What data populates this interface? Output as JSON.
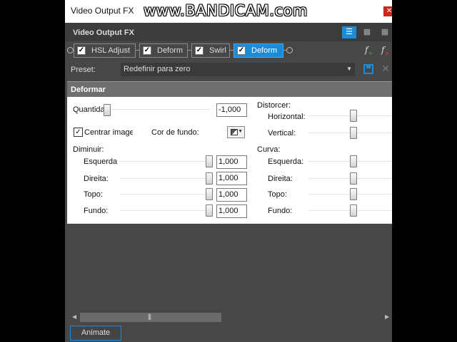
{
  "window": {
    "title": "Video Output FX",
    "close_glyph": "✕"
  },
  "watermark": "www.BANDICAM.com",
  "panel": {
    "title": "Video Output FX"
  },
  "fx_chain": [
    {
      "label": "HSL Adjust",
      "checked": true,
      "selected": false
    },
    {
      "label": "Deform",
      "checked": true,
      "selected": false
    },
    {
      "label": "Swirl",
      "checked": true,
      "selected": false
    },
    {
      "label": "Deform",
      "checked": true,
      "selected": true
    }
  ],
  "preset": {
    "label": "Preset:",
    "value": "Redefinir para zero"
  },
  "section": {
    "title": "Deformar"
  },
  "quantidade": {
    "label": "Quantida",
    "value": "-1,000"
  },
  "centrar": {
    "label": "Centrar imagem",
    "checked": true
  },
  "cor_fundo": {
    "label": "Cor de fundo:"
  },
  "distorcer": {
    "label": "Distorcer:",
    "horizontal": "Horizontal:",
    "vertical": "Vertical:"
  },
  "diminuir": {
    "label": "Diminuir:",
    "rows": [
      {
        "label": "Esquerda",
        "value": "1,000"
      },
      {
        "label": "Direita:",
        "value": "1,000"
      },
      {
        "label": "Topo:",
        "value": "1,000"
      },
      {
        "label": "Fundo:",
        "value": "1,000"
      }
    ]
  },
  "curva": {
    "label": "Curva:",
    "rows": [
      {
        "label": "Esquerda:"
      },
      {
        "label": "Direita:"
      },
      {
        "label": "Topo:"
      },
      {
        "label": "Fundo:"
      }
    ]
  },
  "footer": {
    "animate_label": "Animate"
  },
  "colors": {
    "accent": "#1e8bd6",
    "panel_bg": "#474747",
    "content_bg": "#ffffff",
    "section_header": "#6f6f6f"
  }
}
